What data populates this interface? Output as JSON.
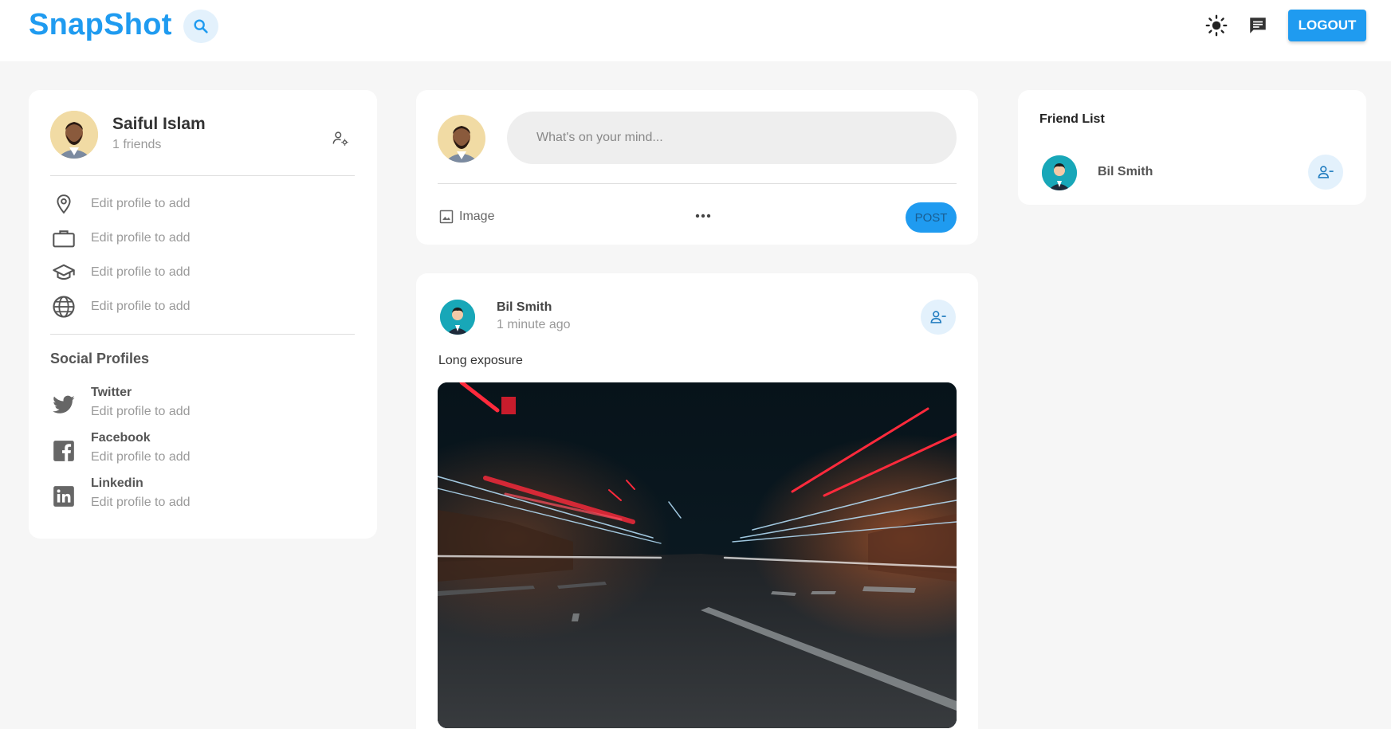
{
  "header": {
    "logo": "SnapShot",
    "icons": [
      "search-icon",
      "sun-icon",
      "chat-icon"
    ],
    "logout_label": "LOGOUT",
    "brand_color": "#1f9bf0"
  },
  "profile": {
    "name": "Saiful Islam",
    "friends": "1 friends",
    "info": [
      {
        "icon": "location-icon",
        "text": "Edit profile to add"
      },
      {
        "icon": "briefcase-icon",
        "text": "Edit profile to add"
      },
      {
        "icon": "graduation-cap-icon",
        "text": "Edit profile to add"
      },
      {
        "icon": "globe-icon",
        "text": "Edit profile to add"
      }
    ],
    "social_heading": "Social Profiles",
    "socials": [
      {
        "name": "Twitter",
        "text": "Edit profile to add",
        "icon": "twitter-icon"
      },
      {
        "name": "Facebook",
        "text": "Edit profile to add",
        "icon": "facebook-icon"
      },
      {
        "name": "Linkedin",
        "text": "Edit profile to add",
        "icon": "linkedin-icon"
      }
    ]
  },
  "composer": {
    "placeholder": "What's on your mind...",
    "image_label": "Image",
    "post_label": "POST"
  },
  "post": {
    "author": "Bil Smith",
    "time": "1 minute ago",
    "caption": "Long exposure"
  },
  "friend_list": {
    "title": "Friend List",
    "friends": [
      {
        "name": "Bil Smith"
      }
    ]
  }
}
